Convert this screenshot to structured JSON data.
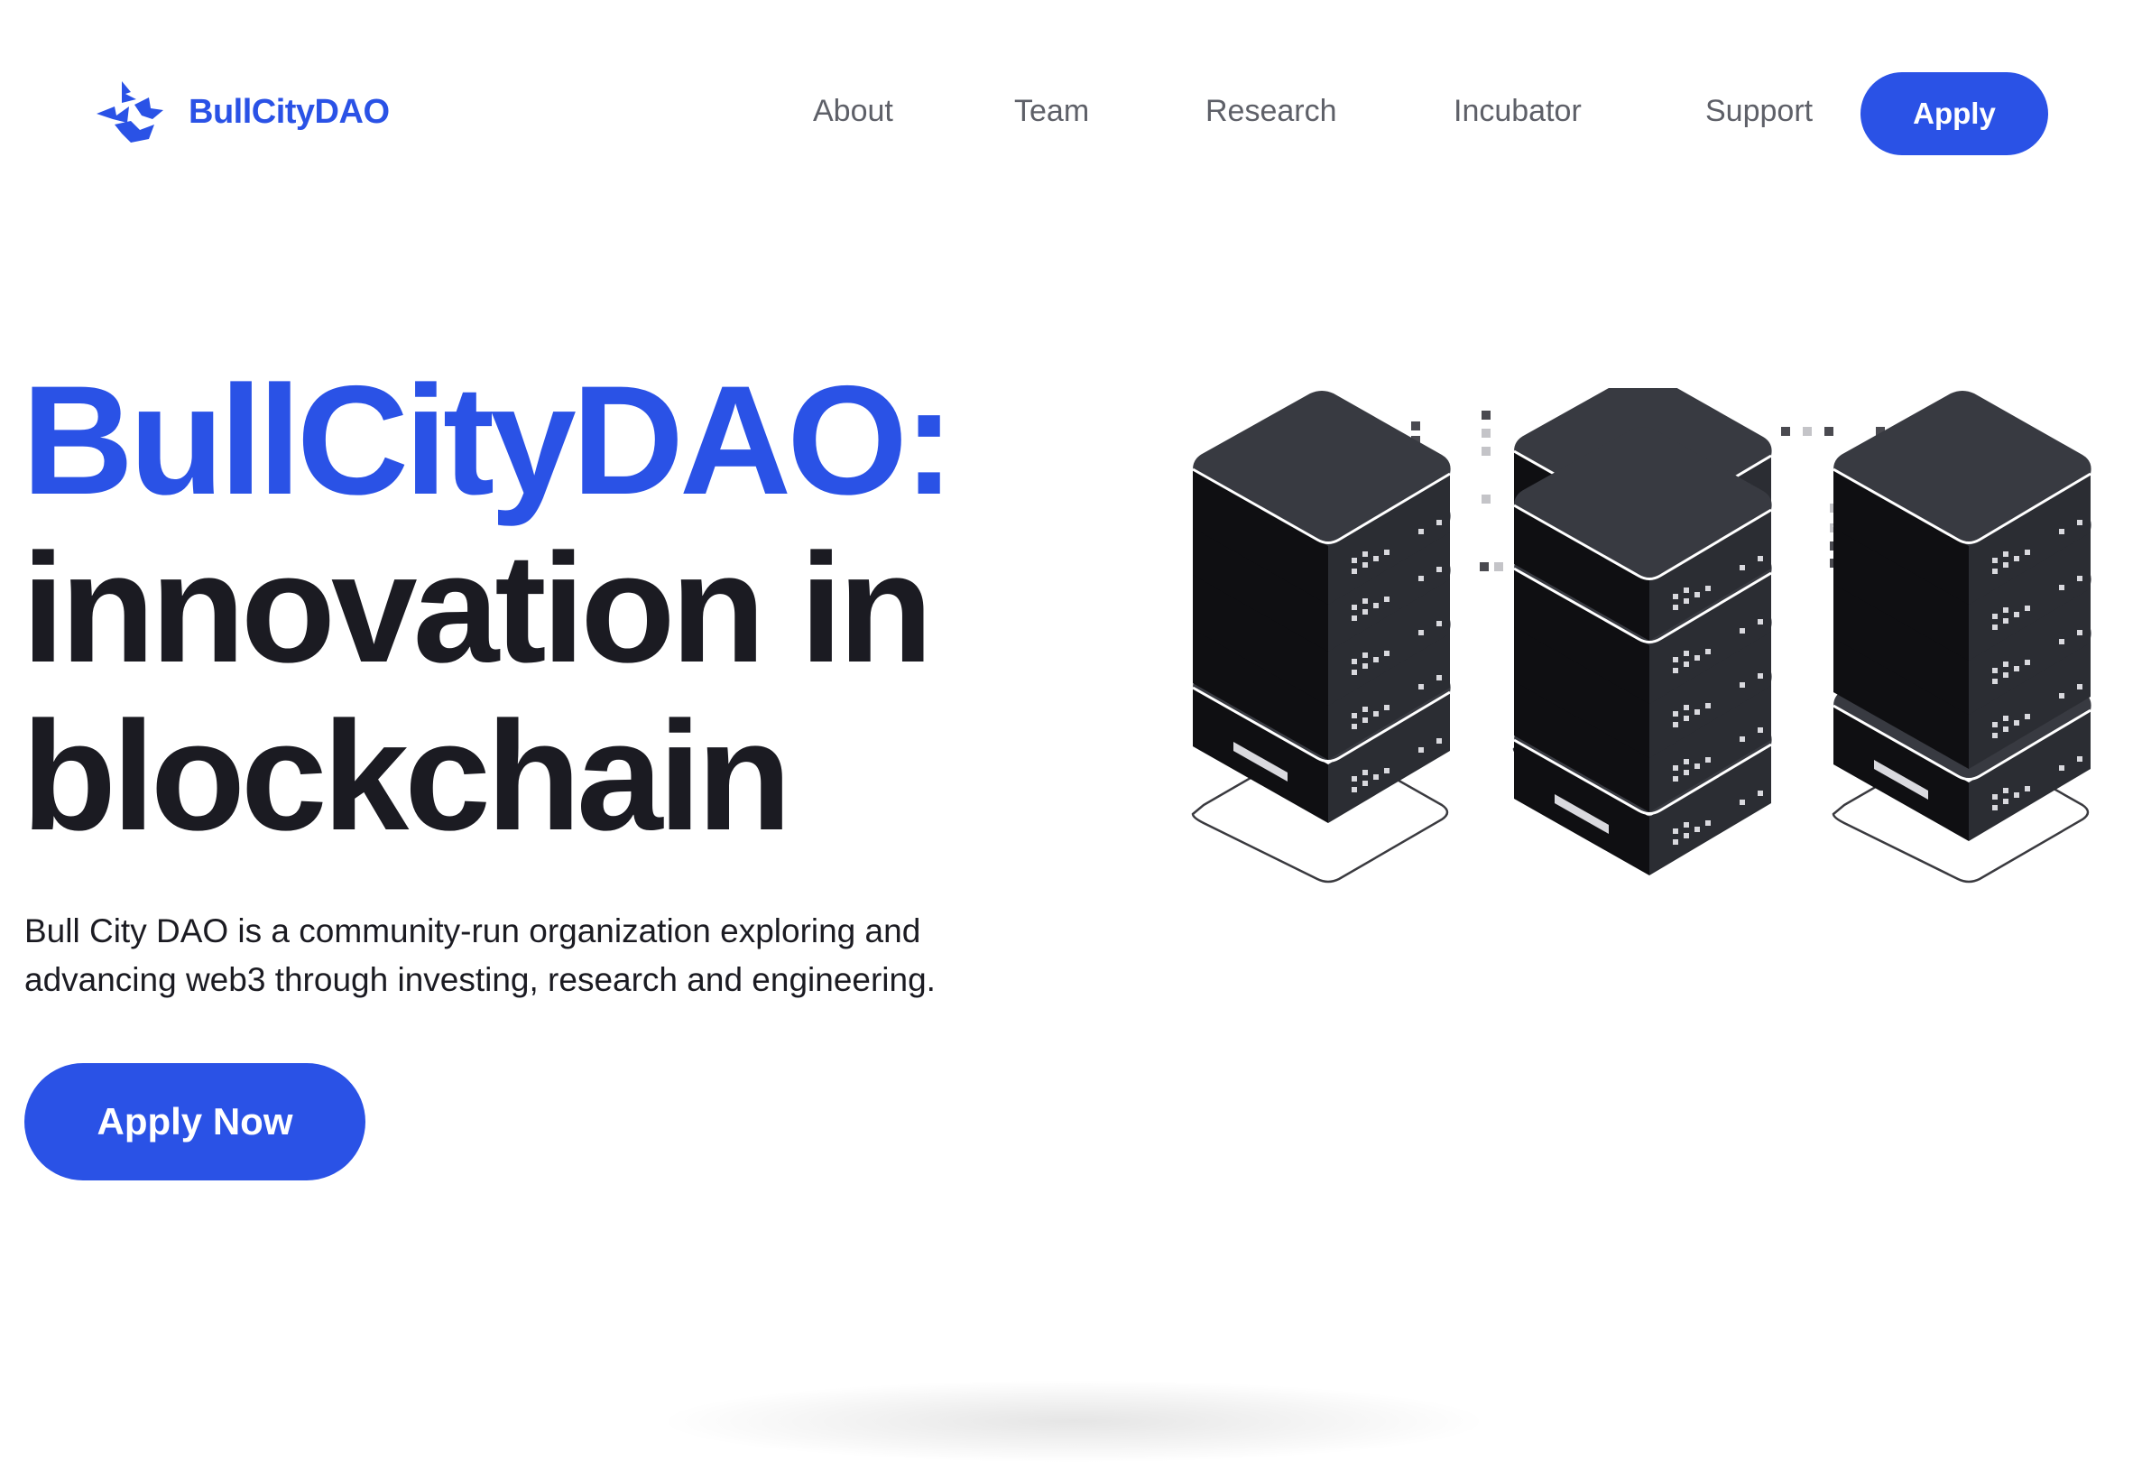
{
  "brand": {
    "name": "BullCityDAO",
    "color": "#2a52e6"
  },
  "nav": {
    "items": [
      {
        "label": "About"
      },
      {
        "label": "Team"
      },
      {
        "label": "Research"
      },
      {
        "label": "Incubator"
      },
      {
        "label": "Support"
      }
    ],
    "apply_label": "Apply"
  },
  "hero": {
    "title_accent": "BullCityDAO:",
    "title_line2": "innovation in",
    "title_line3": "blockchain",
    "description": "Bull City DAO is a community-run organization exploring and advancing web3 through investing, research and engineering.",
    "cta_label": "Apply Now"
  },
  "illustration": {
    "icon": "server-racks-illustration",
    "colors": {
      "dark": "#33353b",
      "shade": "#111114",
      "outline": "#ffffff"
    }
  }
}
